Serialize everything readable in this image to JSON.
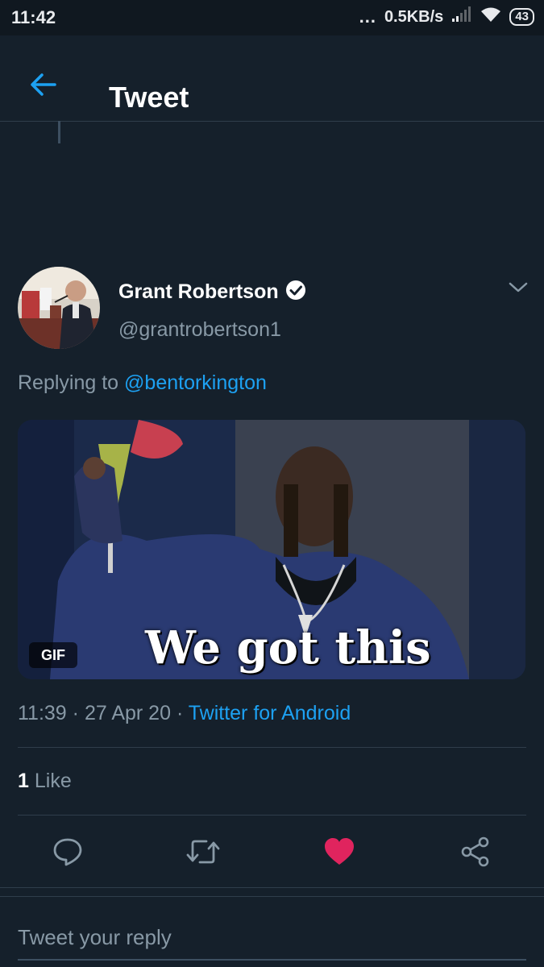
{
  "status_bar": {
    "time": "11:42",
    "dots": "...",
    "speed": "0.5KB/s",
    "battery": "43"
  },
  "header": {
    "title": "Tweet"
  },
  "tweet": {
    "author_name": "Grant Robertson",
    "author_handle": "@grantrobertson1",
    "replying_prefix": "Replying to",
    "replying_to": "@bentorkington",
    "media": {
      "badge": "GIF",
      "caption": "We got this"
    },
    "time": "11:39",
    "separator1": "·",
    "date": "27 Apr 20",
    "separator2": "·",
    "source": "Twitter for Android",
    "likes_count": "1",
    "likes_label": "Like"
  },
  "reply": {
    "placeholder": "Tweet your reply"
  },
  "colors": {
    "background": "#15202b",
    "accent": "#1da1f2",
    "like": "#e0245e",
    "muted": "#8899a6"
  },
  "icons": [
    "back-arrow-icon",
    "verified-badge-icon",
    "chevron-down-icon",
    "reply-icon",
    "retweet-icon",
    "heart-icon",
    "share-icon",
    "wifi-icon",
    "signal-icon"
  ]
}
